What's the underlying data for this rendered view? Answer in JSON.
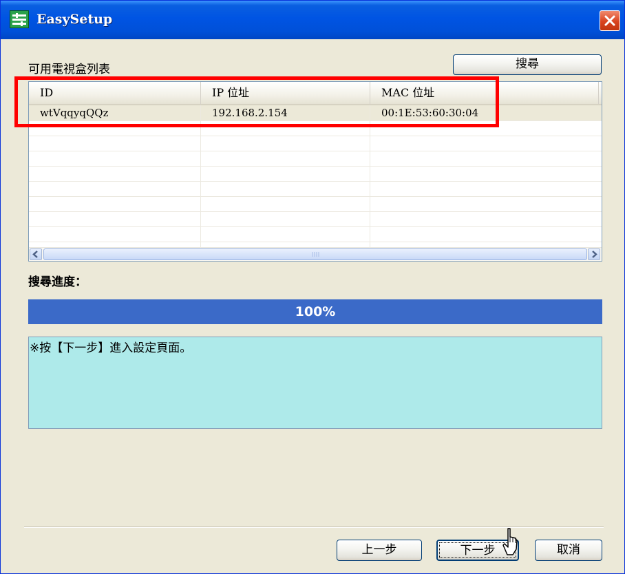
{
  "window": {
    "title": "EasySetup"
  },
  "list_section": {
    "label": "可用電視盒列表",
    "search_button": "搜尋"
  },
  "table": {
    "columns": [
      "ID",
      "IP 位址",
      "MAC 位址"
    ],
    "rows": [
      {
        "id": "wtVqqyqQQz",
        "ip": "192.168.2.154",
        "mac": "00:1E:53:60:30:04"
      }
    ]
  },
  "progress": {
    "label": "搜尋進度：",
    "text": "100%",
    "value": 100
  },
  "message": "※按【下一步】進入設定頁面。",
  "buttons": {
    "back": "上一步",
    "next": "下一步",
    "cancel": "取消"
  },
  "colors": {
    "titlebar": "#0054e3",
    "progress": "#3b6ac8",
    "message_bg": "#aeeaea",
    "annotation": "#ff0000"
  }
}
